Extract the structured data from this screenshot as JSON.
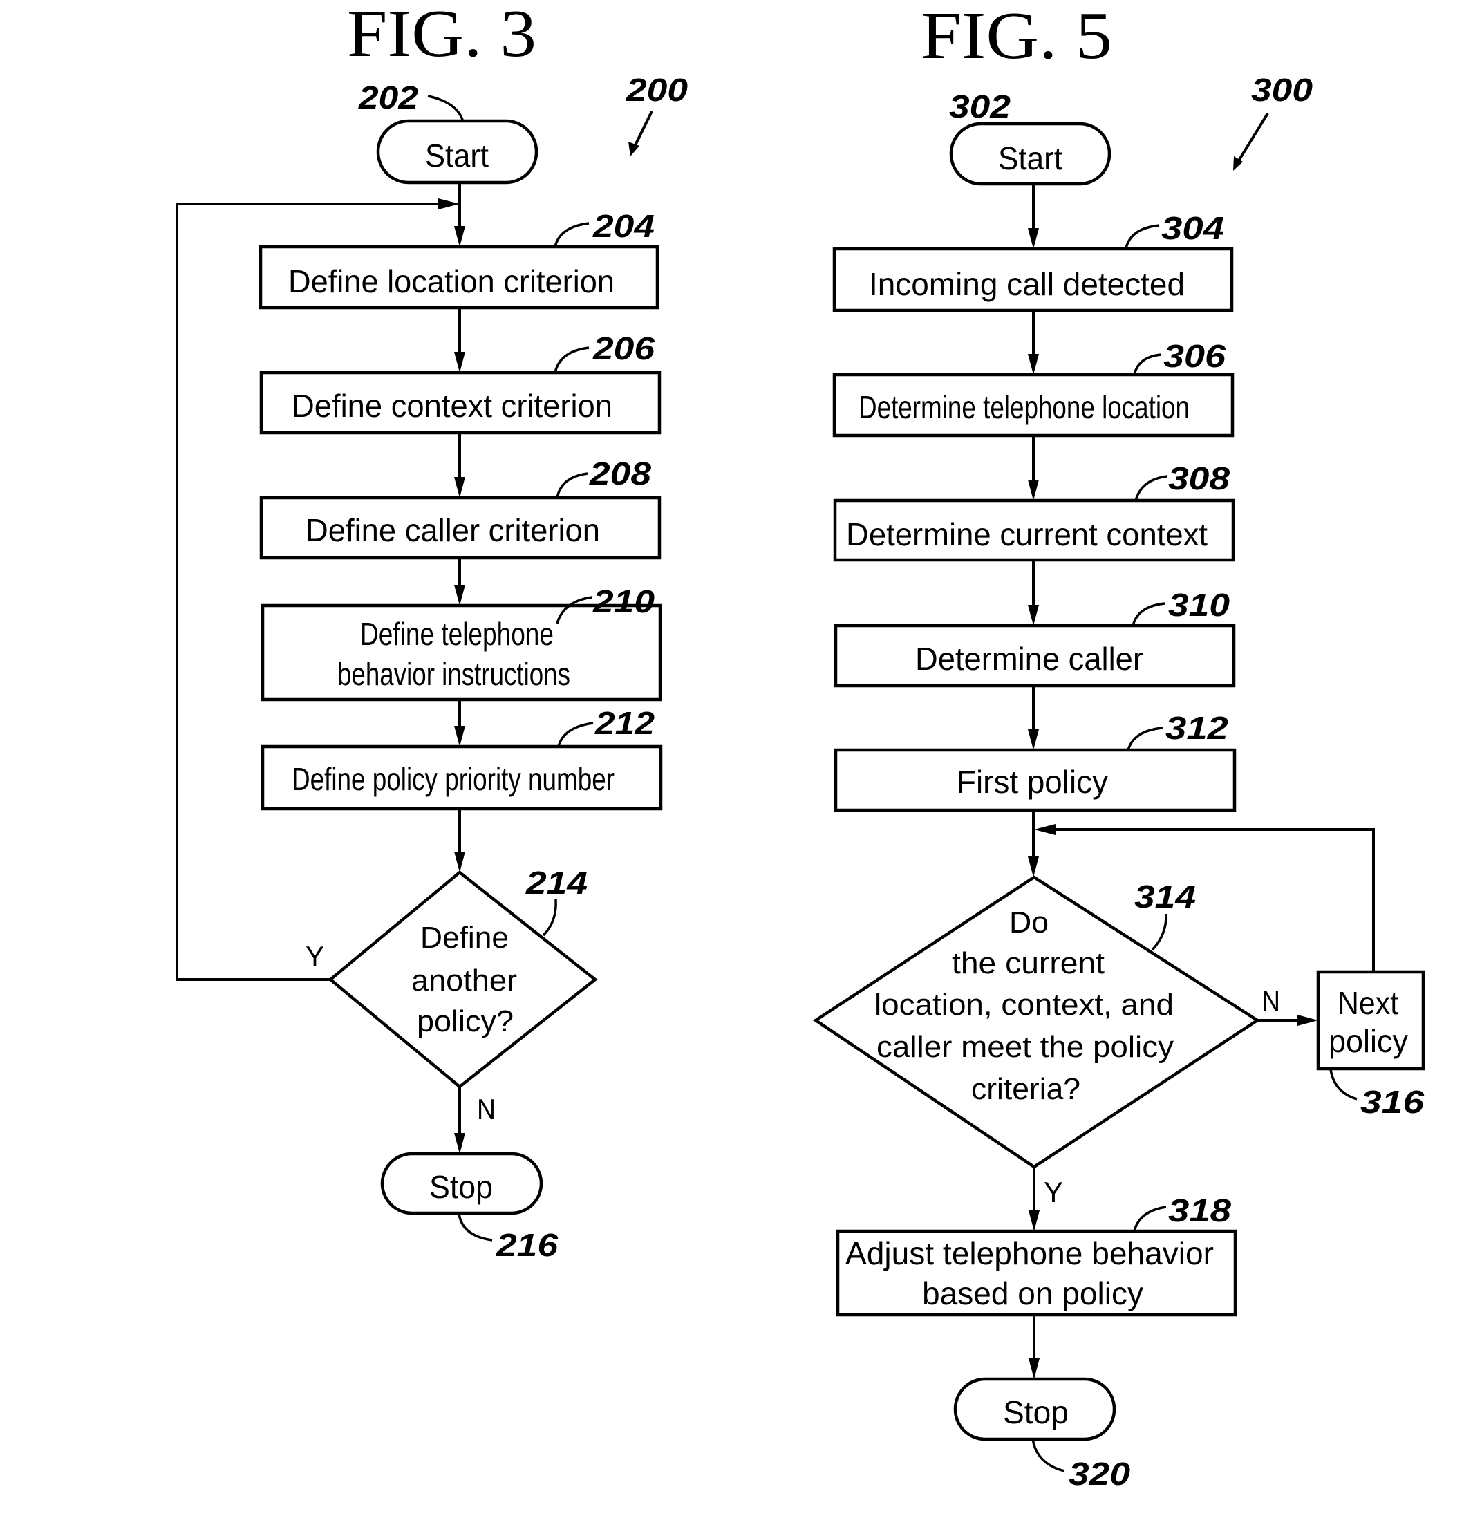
{
  "fig3": {
    "title": "FIG. 3",
    "ref": "200",
    "start": {
      "label": "Start",
      "ref": "202"
    },
    "steps": [
      {
        "ref": "204",
        "lines": [
          "Define location criterion"
        ]
      },
      {
        "ref": "206",
        "lines": [
          "Define context criterion"
        ]
      },
      {
        "ref": "208",
        "lines": [
          "Define caller criterion"
        ]
      },
      {
        "ref": "210",
        "lines": [
          "Define telephone",
          "behavior instructions"
        ]
      },
      {
        "ref": "212",
        "lines": [
          "Define policy priority number"
        ]
      }
    ],
    "decision": {
      "ref": "214",
      "lines": [
        "Define",
        "another",
        "policy?"
      ],
      "yes": "Y",
      "no": "N"
    },
    "stop": {
      "label": "Stop",
      "ref": "216"
    }
  },
  "fig5": {
    "title": "FIG. 5",
    "ref": "300",
    "start": {
      "label": "Start",
      "ref": "302"
    },
    "steps": [
      {
        "ref": "304",
        "lines": [
          "Incoming call detected"
        ]
      },
      {
        "ref": "306",
        "lines": [
          "Determine telephone location"
        ]
      },
      {
        "ref": "308",
        "lines": [
          "Determine current context"
        ]
      },
      {
        "ref": "310",
        "lines": [
          "Determine caller"
        ]
      },
      {
        "ref": "312",
        "lines": [
          "First policy"
        ]
      }
    ],
    "decision": {
      "ref": "314",
      "lines": [
        "Do",
        "the current",
        "location, context, and",
        "caller meet the policy",
        "criteria?"
      ],
      "yes": "Y",
      "no": "N"
    },
    "next": {
      "ref": "316",
      "lines": [
        "Next",
        "policy"
      ]
    },
    "adjust": {
      "ref": "318",
      "lines": [
        "Adjust telephone behavior",
        "based on policy"
      ]
    },
    "stop": {
      "label": "Stop",
      "ref": "320"
    }
  }
}
